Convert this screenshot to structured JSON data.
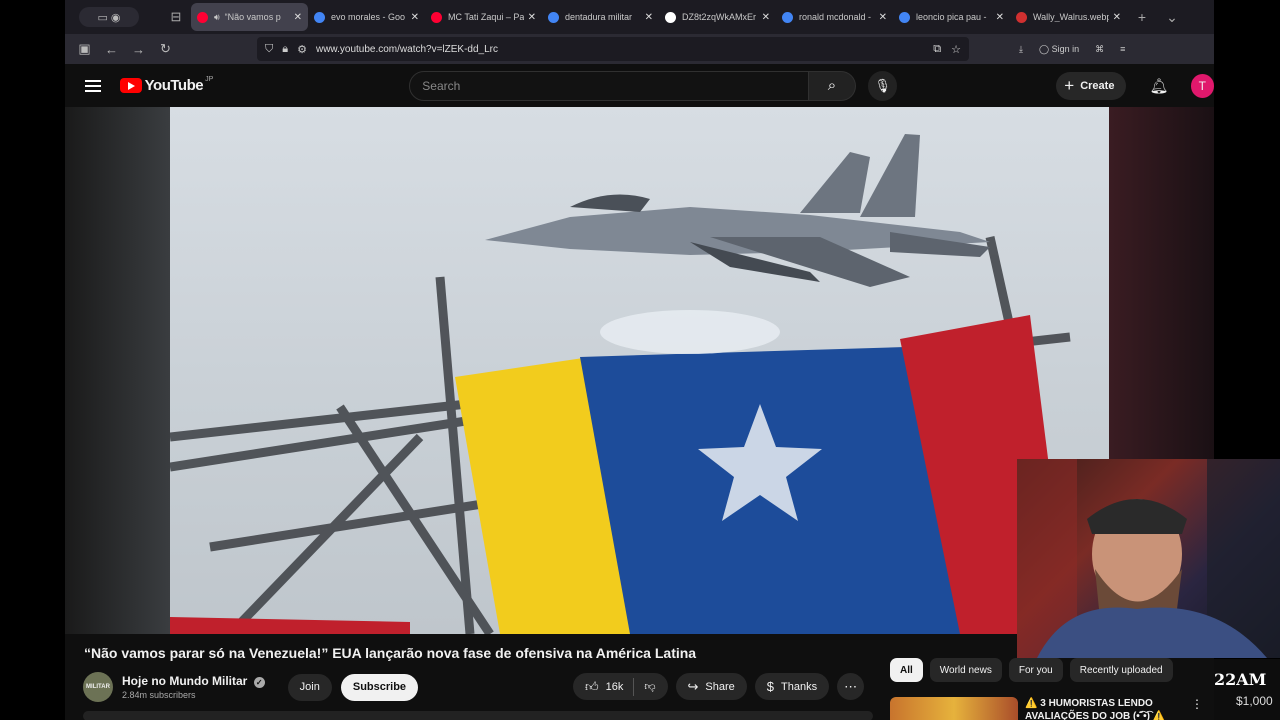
{
  "browser": {
    "tabs": [
      {
        "title": "“Não vamos p",
        "favicon_color": "#ff0033",
        "active": true,
        "audio": true
      },
      {
        "title": "evo morales - Goo",
        "favicon_color": "#4285f4",
        "active": false
      },
      {
        "title": "MC Tati Zaqui – Pa",
        "favicon_color": "#ff0033",
        "active": false
      },
      {
        "title": "dentadura militar",
        "favicon_color": "#4285f4",
        "active": false
      },
      {
        "title": "DZ8t2zqWkAMxEr",
        "favicon_color": "#ffffff",
        "active": false
      },
      {
        "title": "ronald mcdonald -",
        "favicon_color": "#4285f4",
        "active": false
      },
      {
        "title": "leoncio pica pau -",
        "favicon_color": "#4285f4",
        "active": false
      },
      {
        "title": "Wally_Walrus.webp",
        "favicon_color": "#d03030",
        "active": false
      }
    ],
    "url": "www.youtube.com/watch?v=lZEK-dd_Lrc",
    "sign_in": "Sign in"
  },
  "youtube": {
    "logo_text": "YouTube",
    "country_code": "JP",
    "search_placeholder": "Search",
    "create_label": "Create",
    "avatar_letter": "T"
  },
  "video": {
    "title": "“Não vamos parar só na Venezuela!” EUA lançarão nova fase de ofensiva na América Latina",
    "channel_name": "Hoje no Mundo Militar",
    "channel_avatar_text": "MILITAR",
    "subscribers": "2.84m subscribers",
    "join_label": "Join",
    "subscribe_label": "Subscribe",
    "likes": "16k",
    "share_label": "Share",
    "thanks_label": "Thanks"
  },
  "sidebar": {
    "chips": [
      "All",
      "World news",
      "For you",
      "Recently uploaded"
    ],
    "recommendation_title": "⚠️ 3 HUMORISTAS LENDO AVALIAÇÕES DO JOB (•͡˘•͡) ⚠️"
  },
  "overlay": {
    "clock": "22AM",
    "money": "$1,000"
  },
  "colors": {
    "yt_red": "#ff0000",
    "avatar": "#e0186c",
    "flag_yellow": "#f2cc1d",
    "flag_blue": "#1d4c9a",
    "flag_red": "#c0202c"
  }
}
